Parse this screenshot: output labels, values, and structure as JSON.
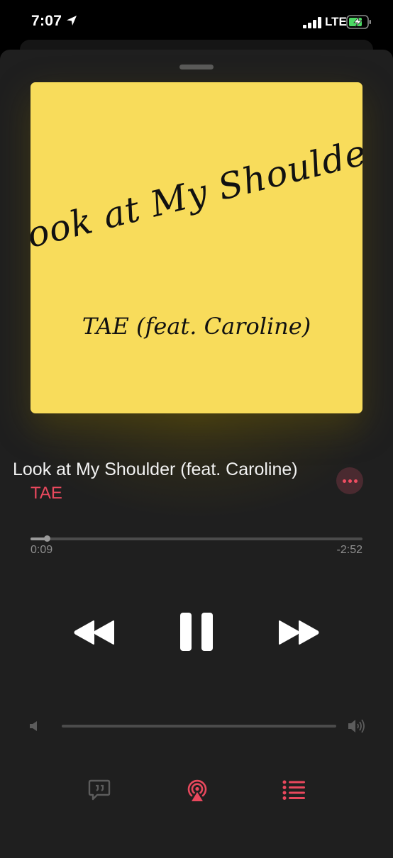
{
  "status_bar": {
    "time": "7:07",
    "network": "LTE",
    "icons": [
      "location-arrow-icon",
      "signal-bars-icon",
      "battery-charging-icon"
    ]
  },
  "artwork": {
    "title_text": "Look at My Shoulder",
    "artist_text": "TAE (feat. Caroline)",
    "background_color": "#f8dc5b"
  },
  "song": {
    "title": "Look at My Shoulder (feat. Caroline)",
    "artist": "TAE"
  },
  "progress": {
    "elapsed": "0:09",
    "remaining": "-2:52",
    "fraction": 0.05
  },
  "controls": {
    "icons": [
      "rewind-icon",
      "pause-icon",
      "fast-forward-icon"
    ]
  },
  "volume": {
    "level": 0.0,
    "icons": [
      "volume-low-icon",
      "volume-high-icon"
    ]
  },
  "bottom_bar": {
    "icons": [
      "lyrics-icon",
      "airplay-icon",
      "queue-list-icon"
    ]
  },
  "colors": {
    "accent": "#e8485d",
    "background": "#1f1f1f",
    "artwork": "#f8dc5b"
  }
}
